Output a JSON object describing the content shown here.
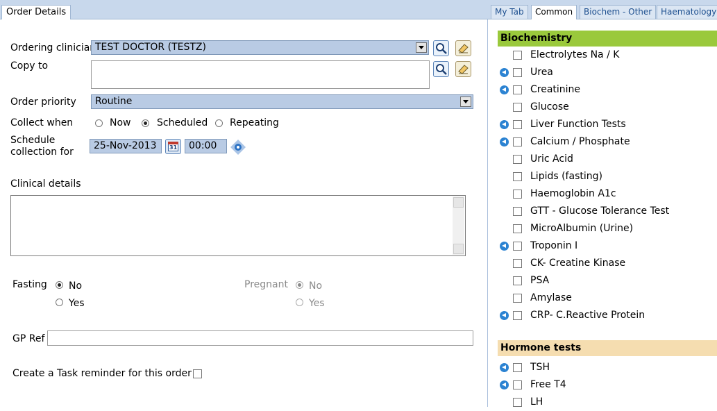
{
  "left_tabs": [
    {
      "label": "Order Details",
      "active": true
    }
  ],
  "form": {
    "ordering_clinician_label": "Ordering clinician",
    "ordering_clinician_value": "TEST DOCTOR (TESTZ)",
    "copy_to_label": "Copy to",
    "copy_to_value": "",
    "order_priority_label": "Order priority",
    "order_priority_value": "Routine",
    "collect_when_label": "Collect when",
    "collect_options": [
      "Now",
      "Scheduled",
      "Repeating"
    ],
    "collect_selected": "Scheduled",
    "schedule_label_line1": "Schedule",
    "schedule_label_line2": "collection for",
    "schedule_date": "25-Nov-2013",
    "schedule_time": "00:00",
    "calendar_icon_text": "31",
    "clinical_details_label": "Clinical details",
    "clinical_details_value": "",
    "fasting_label": "Fasting",
    "fasting_options": [
      "No",
      "Yes"
    ],
    "fasting_selected": "No",
    "pregnant_label": "Pregnant",
    "pregnant_options": [
      "No",
      "Yes"
    ],
    "pregnant_selected": "No",
    "gp_ref_label": "GP Ref",
    "gp_ref_value": "",
    "task_reminder_label": "Create a Task reminder for this order",
    "task_reminder_checked": false
  },
  "right_tabs": [
    {
      "label": "My Tab",
      "active": false
    },
    {
      "label": "Common",
      "active": true
    },
    {
      "label": "Biochem - Other",
      "active": false
    },
    {
      "label": "Haematology",
      "active": false
    }
  ],
  "sections": [
    {
      "title": "Biochemistry",
      "color": "#9ac93c",
      "tests": [
        {
          "name": "Electrolytes Na / K",
          "info": false
        },
        {
          "name": "Urea",
          "info": true
        },
        {
          "name": "Creatinine",
          "info": true
        },
        {
          "name": "Glucose",
          "info": false
        },
        {
          "name": "Liver Function Tests",
          "info": true
        },
        {
          "name": "Calcium / Phosphate",
          "info": true
        },
        {
          "name": "Uric Acid",
          "info": false
        },
        {
          "name": "Lipids (fasting)",
          "info": false
        },
        {
          "name": "Haemoglobin A1c",
          "info": false
        },
        {
          "name": "GTT - Glucose Tolerance Test",
          "info": false
        },
        {
          "name": "MicroAlbumin (Urine)",
          "info": false
        },
        {
          "name": "Troponin I",
          "info": true
        },
        {
          "name": "CK- Creatine Kinase",
          "info": false
        },
        {
          "name": "PSA",
          "info": false
        },
        {
          "name": "Amylase",
          "info": false
        },
        {
          "name": "CRP- C.Reactive Protein",
          "info": true
        }
      ]
    },
    {
      "title": "Hormone tests",
      "color": "#f5ddb0",
      "tests": [
        {
          "name": "TSH",
          "info": true
        },
        {
          "name": "Free T4",
          "info": true
        },
        {
          "name": "LH",
          "info": false
        }
      ]
    }
  ],
  "icons": {
    "search": "search-icon",
    "eraser": "eraser-icon",
    "calendar": "calendar-icon",
    "time_spinner": "time-spinner-icon",
    "info": "info-icon"
  }
}
